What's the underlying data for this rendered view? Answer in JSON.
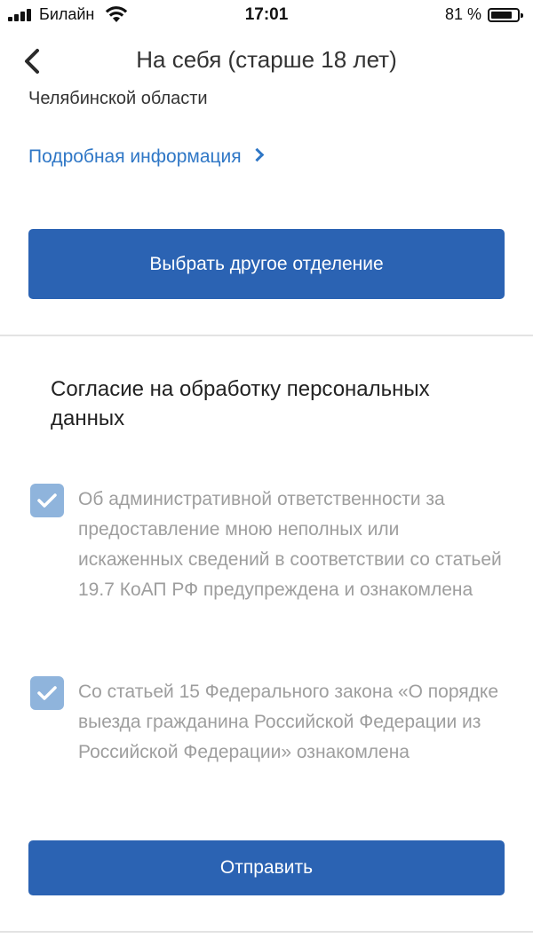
{
  "status_bar": {
    "carrier": "Билайн",
    "time": "17:01",
    "battery_percent": "81 %",
    "battery_level": 0.81
  },
  "nav": {
    "title": "На себя (старше 18 лет)"
  },
  "office": {
    "region_text": "Челябинской области",
    "more_info_link": "Подробная информация",
    "choose_other_button": "Выбрать другое отделение"
  },
  "consent": {
    "title": "Согласие на обработку персональных данных",
    "items": [
      {
        "checked": true,
        "text": "Об административной ответственности за предоставление мною неполных или искаженных сведений в соответствии со статьей 19.7 КоАП РФ предупреждена и ознакомлена"
      },
      {
        "checked": true,
        "text": "Со статьей 15 Федерального закона «О порядке выезда гражданина Российской Федерации из Российской Федерации» ознакомлена"
      }
    ]
  },
  "submit_button": "Отправить",
  "colors": {
    "primary": "#2b63b3",
    "link": "#2f77c6",
    "checkbox": "#8fb4dc",
    "muted_text": "#9e9e9e"
  }
}
